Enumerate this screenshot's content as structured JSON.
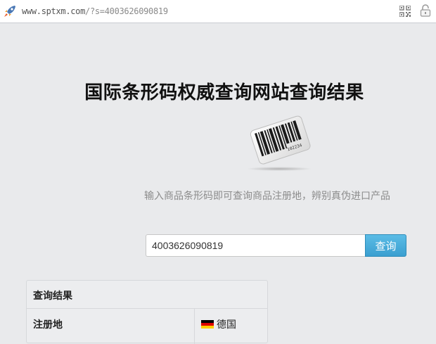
{
  "browser": {
    "url_host": "www.sptxm.com",
    "url_path": "/?s=4003626090819",
    "icons": [
      "rocket-icon",
      "qr-code-icon",
      "lock-icon"
    ]
  },
  "page": {
    "title": "国际条形码权威查询网站查询结果",
    "subtitle": "输入商品条形码即可查询商品注册地，辨别真伪进口产品",
    "logo_icon": "barcode-icon",
    "logo_number": "102234"
  },
  "search": {
    "value": "4003626090819",
    "button_label": "查询"
  },
  "results": {
    "header": "查询结果",
    "rows": [
      {
        "label": "注册地",
        "value": "德国",
        "flag_icon": "germany-flag-icon",
        "flag_colors": [
          "#000000",
          "#dd0000",
          "#ffce00"
        ]
      }
    ]
  },
  "colors": {
    "background": "#e9eaec",
    "button": "#3a9fd0",
    "subtitle_text": "#8c8c8c"
  }
}
